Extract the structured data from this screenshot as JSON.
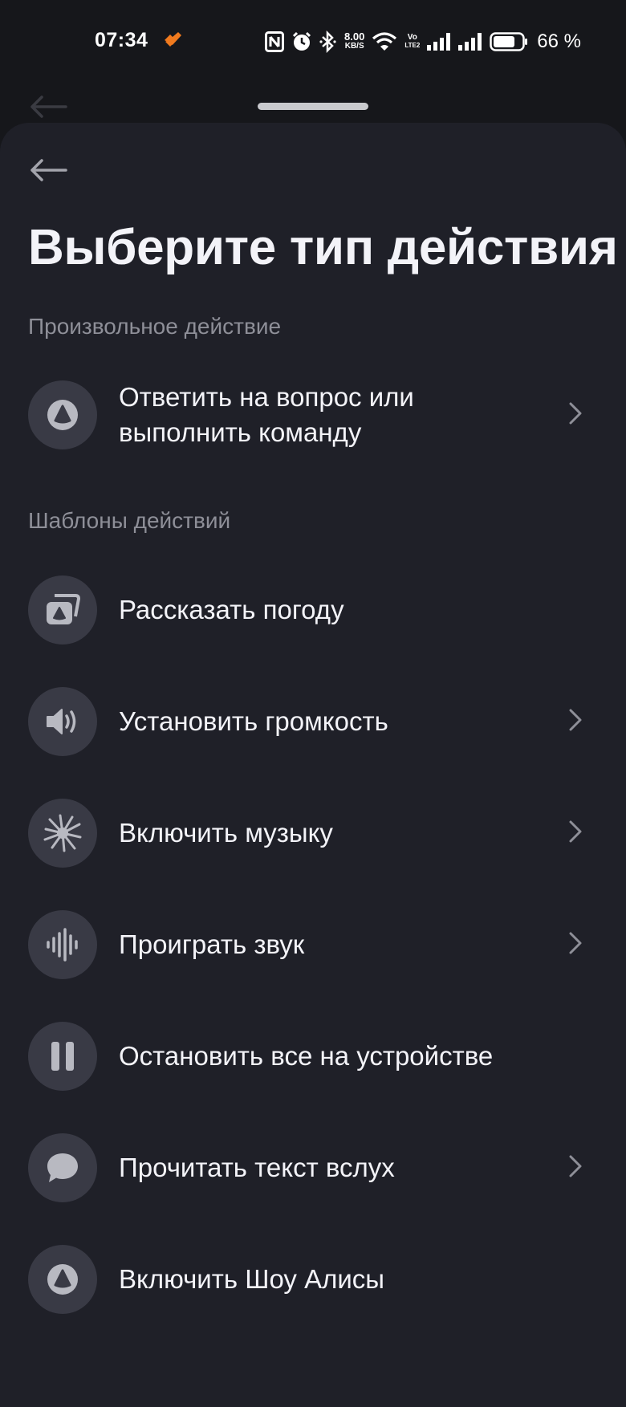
{
  "status_bar": {
    "time": "07:34",
    "net_speed_value": "8.00",
    "net_speed_unit": "KB/S",
    "volte_top": "Vo",
    "volte_bottom": "LTE2",
    "battery": "66 %",
    "icons": [
      "nfc-icon",
      "alarm-icon",
      "bluetooth-icon",
      "wifi-icon",
      "signal-icon",
      "battery-icon"
    ]
  },
  "header": {
    "title": "Выберите тип действия"
  },
  "sections": {
    "custom": {
      "label": "Произвольное действие",
      "items": [
        {
          "label": "Ответить на вопрос или выполнить команду",
          "icon": "alice-icon",
          "chevron": true
        }
      ]
    },
    "templates": {
      "label": "Шаблоны действий",
      "items": [
        {
          "label": "Рассказать погоду",
          "icon": "weather-icon",
          "chevron": false
        },
        {
          "label": "Установить громкость",
          "icon": "volume-icon",
          "chevron": true
        },
        {
          "label": "Включить музыку",
          "icon": "music-icon",
          "chevron": true
        },
        {
          "label": "Проиграть звук",
          "icon": "sound-wave-icon",
          "chevron": true
        },
        {
          "label": "Остановить все на устройстве",
          "icon": "pause-icon",
          "chevron": false
        },
        {
          "label": "Прочитать текст вслух",
          "icon": "speech-bubble-icon",
          "chevron": true
        },
        {
          "label": "Включить Шоу Алисы",
          "icon": "alice-icon",
          "chevron": false
        }
      ]
    }
  },
  "colors": {
    "background": "#16171b",
    "sheet": "#1f2028",
    "icon_circle": "#393a45",
    "text_primary": "#f3f3f8",
    "text_secondary": "#8e8f98",
    "accent_orange": "#f07a1e"
  }
}
